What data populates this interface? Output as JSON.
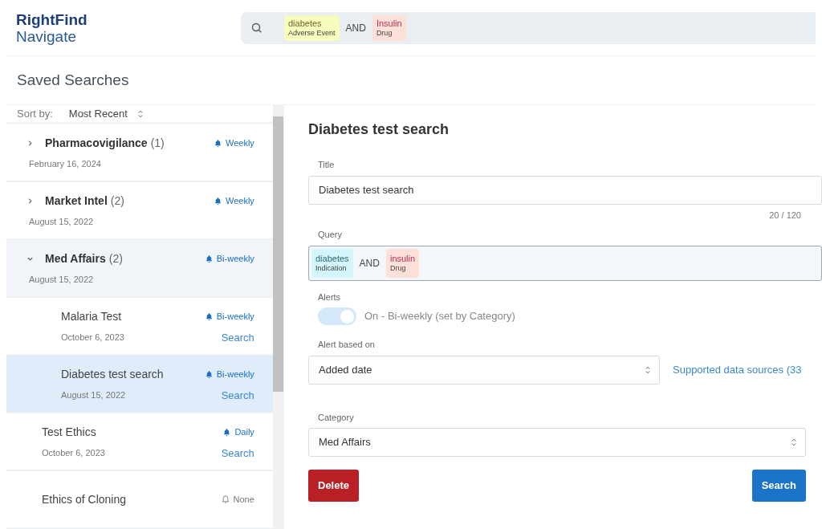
{
  "logo": {
    "line_1": "RightFind",
    "line_2": "Navigate"
  },
  "search_bar": {
    "terms": [
      {
        "kind": "term",
        "text": "diabetes",
        "type": "Adverse Event",
        "color": "#f7fbbd"
      },
      {
        "kind": "operator",
        "text": "AND"
      },
      {
        "kind": "term",
        "text": "Insulin",
        "type": "Drug",
        "color": "#fde0d8"
      }
    ]
  },
  "page_title": "Saved Searches",
  "sort": {
    "label": "Sort by:",
    "value": "Most Recent"
  },
  "sidebar": {
    "items": [
      {
        "kind": "category",
        "name": "Pharmacovigilance",
        "count": "(1)",
        "date": "February 16, 2024",
        "alert": "Weekly",
        "alert_on": true,
        "expanded": false,
        "selected": false
      },
      {
        "kind": "category",
        "name": "Market Intel",
        "count": "(2)",
        "date": "August 15, 2022",
        "alert": "Weekly",
        "alert_on": true,
        "expanded": false,
        "selected": false
      },
      {
        "kind": "category",
        "name": "Med Affairs",
        "count": "(2)",
        "date": "August 15, 2022",
        "alert": "Bi-weekly",
        "alert_on": true,
        "expanded": true,
        "selected": false,
        "children": [
          {
            "kind": "search",
            "name": "Malaria Test",
            "date": "October 6, 2023",
            "alert": "Bi-weekly",
            "alert_on": true,
            "link": "Search",
            "selected": false
          },
          {
            "kind": "search",
            "name": "Diabetes test search",
            "date": "August 15, 2022",
            "alert": "Bi-weekly",
            "alert_on": true,
            "link": "Search",
            "selected": true
          }
        ]
      },
      {
        "kind": "search",
        "name": "Test Ethics",
        "date": "October 6, 2023",
        "alert": "Daily",
        "alert_on": true,
        "link": "Search",
        "selected": false
      },
      {
        "kind": "search",
        "name": "Ethics of Cloning",
        "alert": "None",
        "alert_on": false,
        "selected": false
      }
    ]
  },
  "detail": {
    "heading": "Diabetes test search",
    "title_label": "Title",
    "title_value": "Diabetes test search",
    "counter": "20 / 120",
    "query_label": "Query",
    "query_terms": [
      {
        "kind": "term",
        "text": "diabetes",
        "type": "Indication",
        "color": "#d3f5fb"
      },
      {
        "kind": "operator",
        "text": "AND"
      },
      {
        "kind": "term",
        "text": "insulin",
        "type": "Drug",
        "color": "#fde0d8"
      }
    ],
    "alerts_label": "Alerts",
    "alerts_toggle": {
      "on": true,
      "disabled": true,
      "text": "On - Bi-weekly (set by Category)"
    },
    "alert_based_label": "Alert based on",
    "alert_based_value": "Added date",
    "sources_link": "Supported data sources (33",
    "category_label": "Category",
    "category_value": "Med Affairs",
    "buttons": [
      {
        "kind": "danger",
        "label": "Delete"
      },
      {
        "kind": "primary",
        "label": "Search"
      }
    ]
  }
}
